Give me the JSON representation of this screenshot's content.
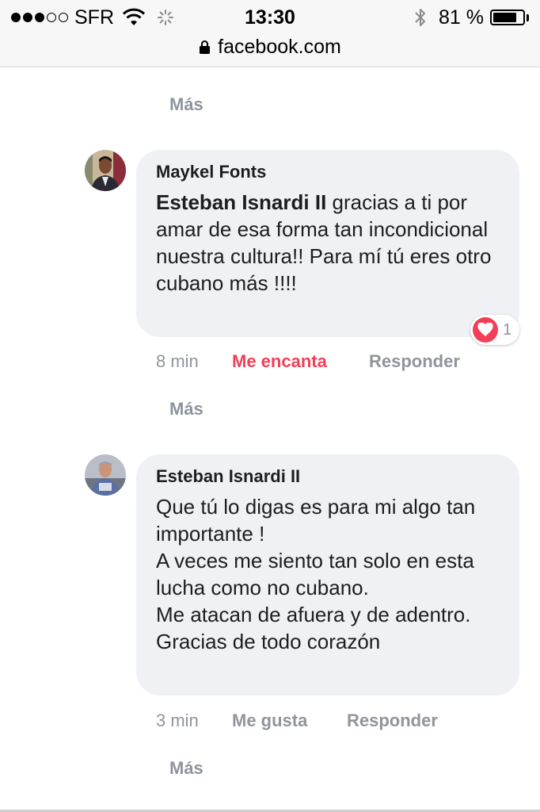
{
  "status_bar": {
    "carrier": "SFR",
    "signal_bars_filled": 3,
    "signal_bars_total": 5,
    "time": "13:30",
    "battery_percent": "81 %",
    "battery_level": 0.81,
    "icons": [
      "wifi-icon",
      "loading-spinner-icon",
      "bluetooth-icon",
      "battery-icon",
      "lock-icon"
    ]
  },
  "browser": {
    "url": "facebook.com"
  },
  "thread": {
    "more_label": "Más",
    "comments": [
      {
        "author": "Maykel Fonts",
        "mention": "Esteban Isnardi II",
        "text": " gracias a ti por amar de esa forma tan incondicional nuestra cultura!! Para mí tú eres otro cubano más !!!!",
        "time": "8 min",
        "like_label": "Me encanta",
        "reply_label": "Responder",
        "reaction_count": "1",
        "reaction_color": "#f33e58"
      },
      {
        "author": "Esteban Isnardi II",
        "lines": [
          "Que tú lo digas es para mi algo tan importante !",
          "A veces me siento tan solo en esta lucha como no cubano.",
          "Me atacan de afuera y de adentro.",
          "Gracias de todo corazón"
        ],
        "time": "3 min",
        "like_label": "Me gusta",
        "reply_label": "Responder"
      }
    ]
  },
  "colors": {
    "bubble": "#f0f1f4",
    "meta_gray": "#90949c",
    "love_red": "#f33e58",
    "text": "#1c1e21"
  }
}
